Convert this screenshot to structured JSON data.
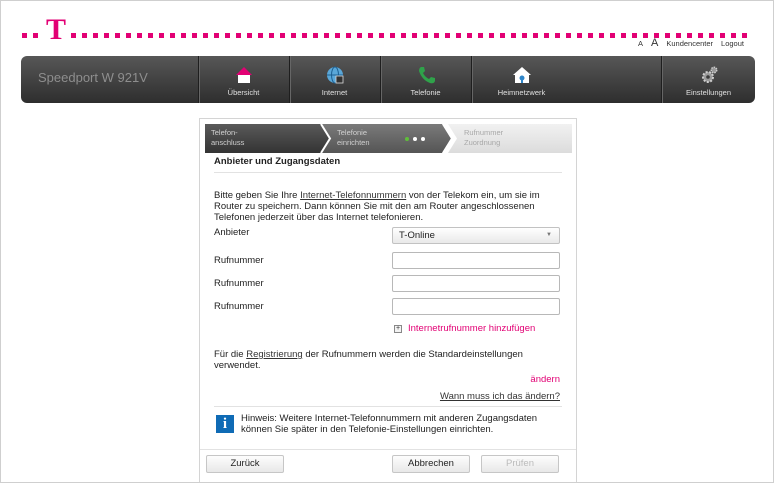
{
  "header": {
    "logo_letter": "T",
    "font_small": "A",
    "font_large": "A",
    "kundencenter": "Kundencenter",
    "logout": "Logout"
  },
  "nav": {
    "brand": "Speedport W 921V",
    "items": [
      {
        "label": "Übersicht",
        "icon": "home-icon"
      },
      {
        "label": "Internet",
        "icon": "globe-icon"
      },
      {
        "label": "Telefonie",
        "icon": "phone-icon"
      },
      {
        "label": "Heimnetzwerk",
        "icon": "home-network-icon"
      },
      {
        "label": "Einstellungen",
        "icon": "gear-icon"
      }
    ]
  },
  "wizard": {
    "steps": [
      {
        "line1": "Telefon-",
        "line2": "anschluss"
      },
      {
        "line1": "Telefonie",
        "line2": "einrichten"
      },
      {
        "line1": "Rufnummer",
        "line2": "Zuordnung"
      }
    ]
  },
  "form": {
    "title": "Anbieter und Zugangsdaten",
    "intro_before": "Bitte geben Sie Ihre ",
    "intro_link": "Internet-Telefonnummern",
    "intro_after": " von der Telekom ein, um sie im Router zu speichern. Dann können Sie mit den am Router angeschlossenen Telefonen jederzeit über das Internet telefonieren.",
    "provider_label": "Anbieter",
    "provider_value": "T-Online",
    "number_label": "Rufnummer",
    "add_number": "Internetrufnummer hinzufügen",
    "reg_before": "Für die ",
    "reg_link": "Registrierung",
    "reg_after": " der Rufnummern werden die Standardeinstellungen verwendet.",
    "change": "ändern",
    "when_change": "Wann muss ich das ändern?",
    "hint": "Hinweis: Weitere Internet-Telefonnummern mit anderen Zugangsdaten können Sie später in den Telefonie-Einstellungen einrichten."
  },
  "buttons": {
    "back": "Zurück",
    "cancel": "Abbrechen",
    "check": "Prüfen"
  },
  "colors": {
    "brand_magenta": "#e20074",
    "info_blue": "#0f6bb5",
    "step_done": "#4f4f4f",
    "step_current": "#6a6a6a",
    "step_pending": "#e2e2e2"
  }
}
